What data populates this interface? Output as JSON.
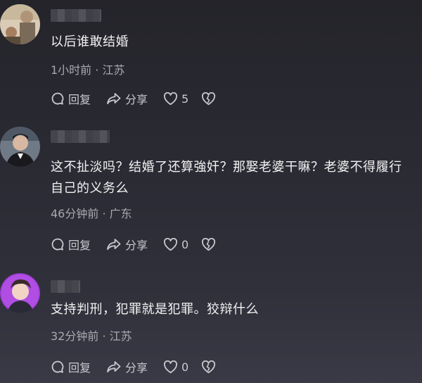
{
  "comments": [
    {
      "text": "以后谁敢结婚",
      "meta": "1小时前 · 江苏",
      "reply_label": "回复",
      "share_label": "分享",
      "like_count": "5"
    },
    {
      "text": "这不扯淡吗？结婚了还算強奸？那娶老婆干嘛？老婆不得履行自己的义务么",
      "meta": "46分钟前 · 广东",
      "reply_label": "回复",
      "share_label": "分享",
      "like_count": "0"
    },
    {
      "text": "支持判刑，犯罪就是犯罪。狡辩什么",
      "meta": "32分钟前 · 江苏",
      "reply_label": "回复",
      "share_label": "分享",
      "like_count": "0"
    }
  ],
  "icons": {
    "reply": "comment-bubble-icon",
    "share": "share-arrow-icon",
    "like": "heart-icon",
    "dislike": "broken-heart-icon"
  },
  "colors": {
    "background": "#2a2a33",
    "text": "#f2f2f2",
    "meta": "#a9a9b1",
    "action": "#c9c9cf"
  }
}
